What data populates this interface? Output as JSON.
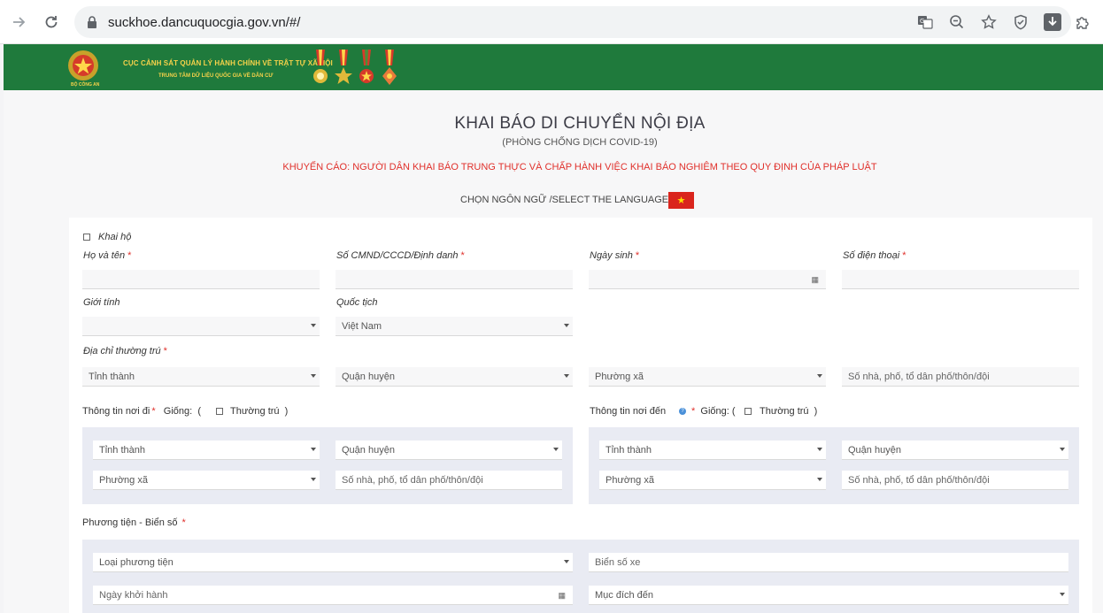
{
  "browser": {
    "url": "suckhoe.dancuquocgia.gov.vn/#/"
  },
  "banner": {
    "org_line1": "CỤC CẢNH SÁT QUẢN LÝ HÀNH CHÍNH VỀ TRẬT TỰ XÃ HỘI",
    "org_line2": "TRUNG TÂM DỮ LIỆU QUỐC GIA VỀ DÂN CƯ",
    "logo_caption": "BỘ CÔNG AN"
  },
  "form": {
    "title": "KHAI BÁO DI CHUYỂN NỘI ĐỊA",
    "subtitle": "(PHÒNG CHỐNG DỊCH COVID-19)",
    "warning": "KHUYẾN CÁO: NGƯỜI DÂN KHAI BÁO TRUNG THỰC VÀ CHẤP HÀNH VIỆC KHAI BÁO NGHIÊM THEO QUY ĐỊNH CỦA PHÁP LUẬT",
    "language_label": "CHỌN NGÔN NGỮ /SELECT THE LANGUAGE:",
    "flag_symbol": "★",
    "required_mark": "*",
    "khai_ho": "Khai hộ",
    "ho_ten": "Họ và tên",
    "cmnd": "Số CMND/CCCD/Định danh",
    "ngay_sinh": "Ngày sinh",
    "so_dien_thoai": "Số điện thoại",
    "gioi_tinh": "Giới tính",
    "quoc_tich": "Quốc tịch",
    "quoc_tich_value": "Việt Nam",
    "dia_chi": "Địa chỉ thường trú",
    "placeholders": {
      "tinh_thanh": "Tỉnh thành",
      "quan_huyen": "Quận huyện",
      "phuong_xa": "Phường xã",
      "so_nha": "Số nhà, phố, tổ dân phố/thôn/đội",
      "loai_phuong_tien": "Loại phương tiện",
      "bien_so_xe": "Biển số xe",
      "ngay_khoi_hanh": "Ngày khởi hành",
      "muc_dich_den": "Mục đích đến"
    },
    "noi_di": {
      "label": "Thông tin nơi đi",
      "giong": "Giống:",
      "open_paren": "(",
      "thuong_tru": "Thường trú",
      "close_paren": ")"
    },
    "noi_den": {
      "label": "Thông tin nơi đến",
      "giong": "Giống:",
      "open_paren": "(",
      "thuong_tru": "Thường trú",
      "close_paren": ")"
    },
    "phuong_tien": "Phương tiện - Biển số"
  }
}
